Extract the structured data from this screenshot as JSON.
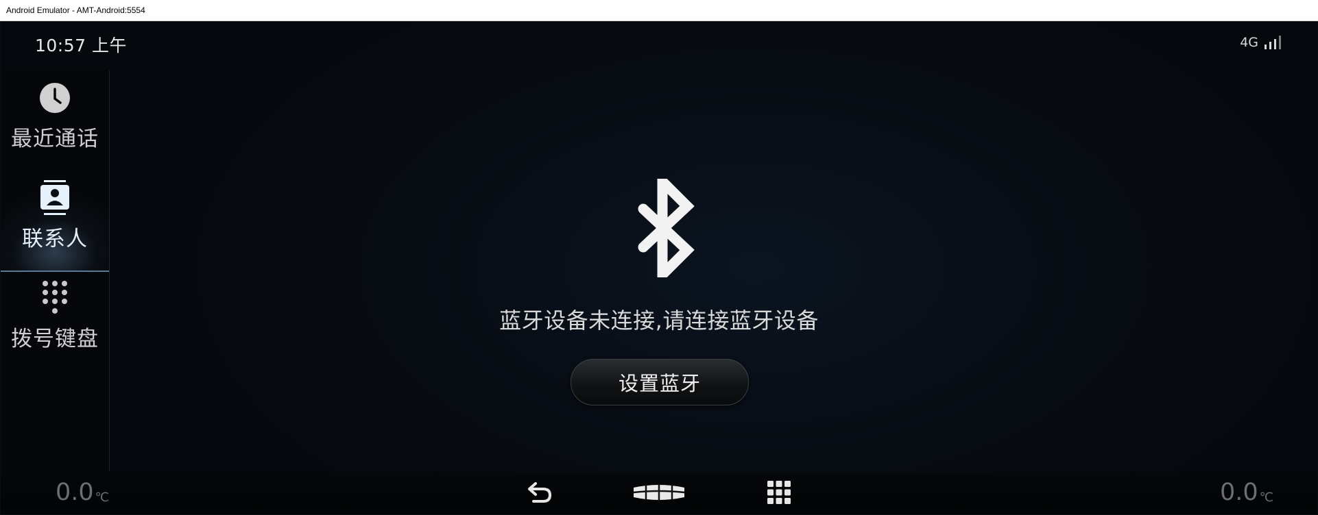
{
  "window": {
    "title": "Android Emulator - AMT-Android:5554"
  },
  "status_bar": {
    "time": "10:57 上午",
    "network": "4G",
    "signal_icon": "signal-bars-icon"
  },
  "sidebar": {
    "items": [
      {
        "label": "最近通话",
        "icon": "clock-icon",
        "active": false
      },
      {
        "label": "联系人",
        "icon": "contacts-icon",
        "active": true
      },
      {
        "label": "拨号键盘",
        "icon": "dialpad-icon",
        "active": false
      }
    ]
  },
  "main": {
    "icon": "bluetooth-icon",
    "message": "蓝牙设备未连接,请连接蓝牙设备",
    "button_label": "设置蓝牙"
  },
  "bottom_bar": {
    "temp_left": "0.0",
    "temp_right": "0.0",
    "temp_unit": "℃",
    "nav": [
      {
        "icon": "back-icon"
      },
      {
        "icon": "home-logo-icon"
      },
      {
        "icon": "app-grid-icon"
      }
    ]
  },
  "colors": {
    "background": "#070b12",
    "text": "#d9d9d9",
    "active_accent": "#5c7a96"
  }
}
